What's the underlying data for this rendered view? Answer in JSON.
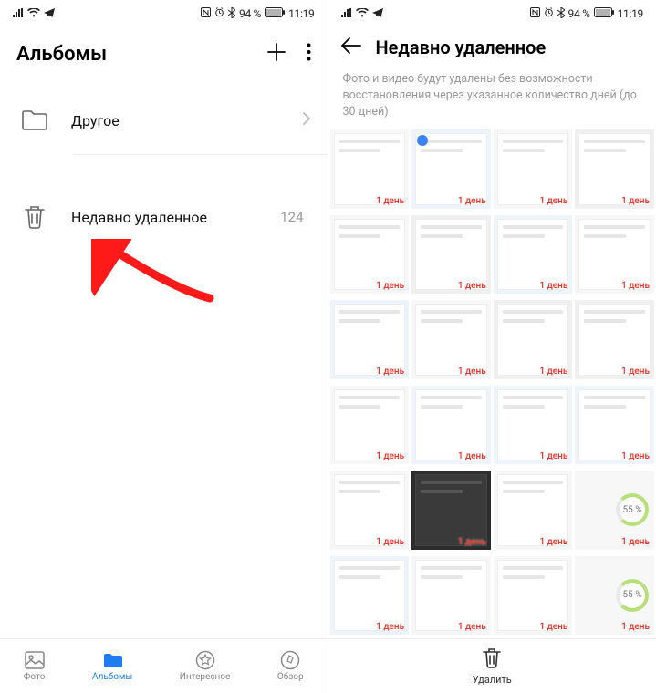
{
  "status": {
    "battery_text": "94 %",
    "time": "11:19"
  },
  "left": {
    "title": "Альбомы",
    "items": [
      {
        "label": "Другое",
        "count": ""
      },
      {
        "label": "Недавно удаленное",
        "count": "124"
      }
    ],
    "nav": [
      {
        "label": "Фото"
      },
      {
        "label": "Альбомы"
      },
      {
        "label": "Интересное"
      },
      {
        "label": "Обзор"
      }
    ]
  },
  "right": {
    "title": "Недавно удаленное",
    "subtitle": "Фото и видео будут удалены без возможности восстановления через указанное количество дней (до 30 дней)",
    "day_label": "1 день",
    "percent_label": "55 %",
    "delete_label": "Удалить"
  }
}
